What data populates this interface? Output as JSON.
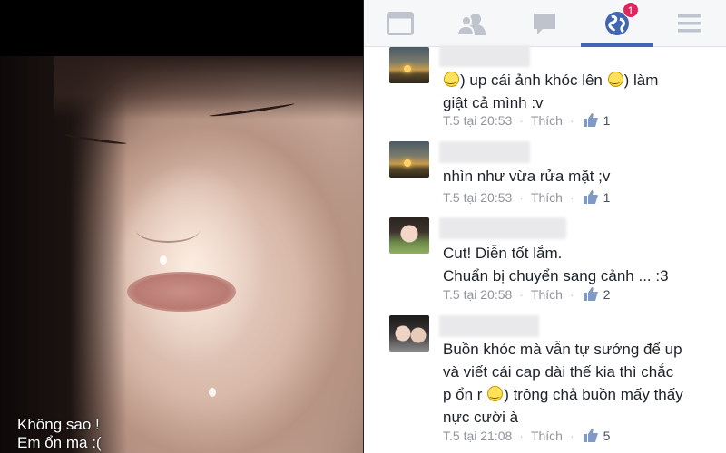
{
  "photo": {
    "caption_line1": "Không sao !",
    "caption_line2": "Em ổn ma :("
  },
  "nav": {
    "icons": [
      "browser-icon",
      "friends-icon",
      "messages-icon",
      "notifications-globe-icon",
      "menu-icon"
    ],
    "active_index": 3,
    "badge": "1",
    "colors": {
      "active": "#4267b2",
      "badge": "#e0245e",
      "icon": "#bfc3cb"
    }
  },
  "comments": [
    {
      "text_parts": [
        "smiley",
        ") up cái ảnh khóc lên ",
        "smiley",
        ") làm\ngiật cả mình :v"
      ],
      "time": "T.5 tại 20:53",
      "like_label": "Thích",
      "like_count": "1"
    },
    {
      "text": "nhìn như vừa rửa mặt ;v",
      "time": "T.5 tại 20:53",
      "like_label": "Thích",
      "like_count": "1"
    },
    {
      "text": "Cut! Diễn tốt lắm.\nChuẩn bị chuyển sang cảnh ... :3",
      "time": "T.5 tại 20:58",
      "like_label": "Thích",
      "like_count": "2"
    },
    {
      "text_a": "Buồn khóc mà vẫn tự sướng để up\nvà viết cái cap dài thế kia thì chắc\np ổn r ",
      "text_b": ") trông chả buồn mấy thấy\nnực cười à",
      "time": "T.5 tại 21:08",
      "like_label": "Thích",
      "like_count": "5"
    }
  ]
}
